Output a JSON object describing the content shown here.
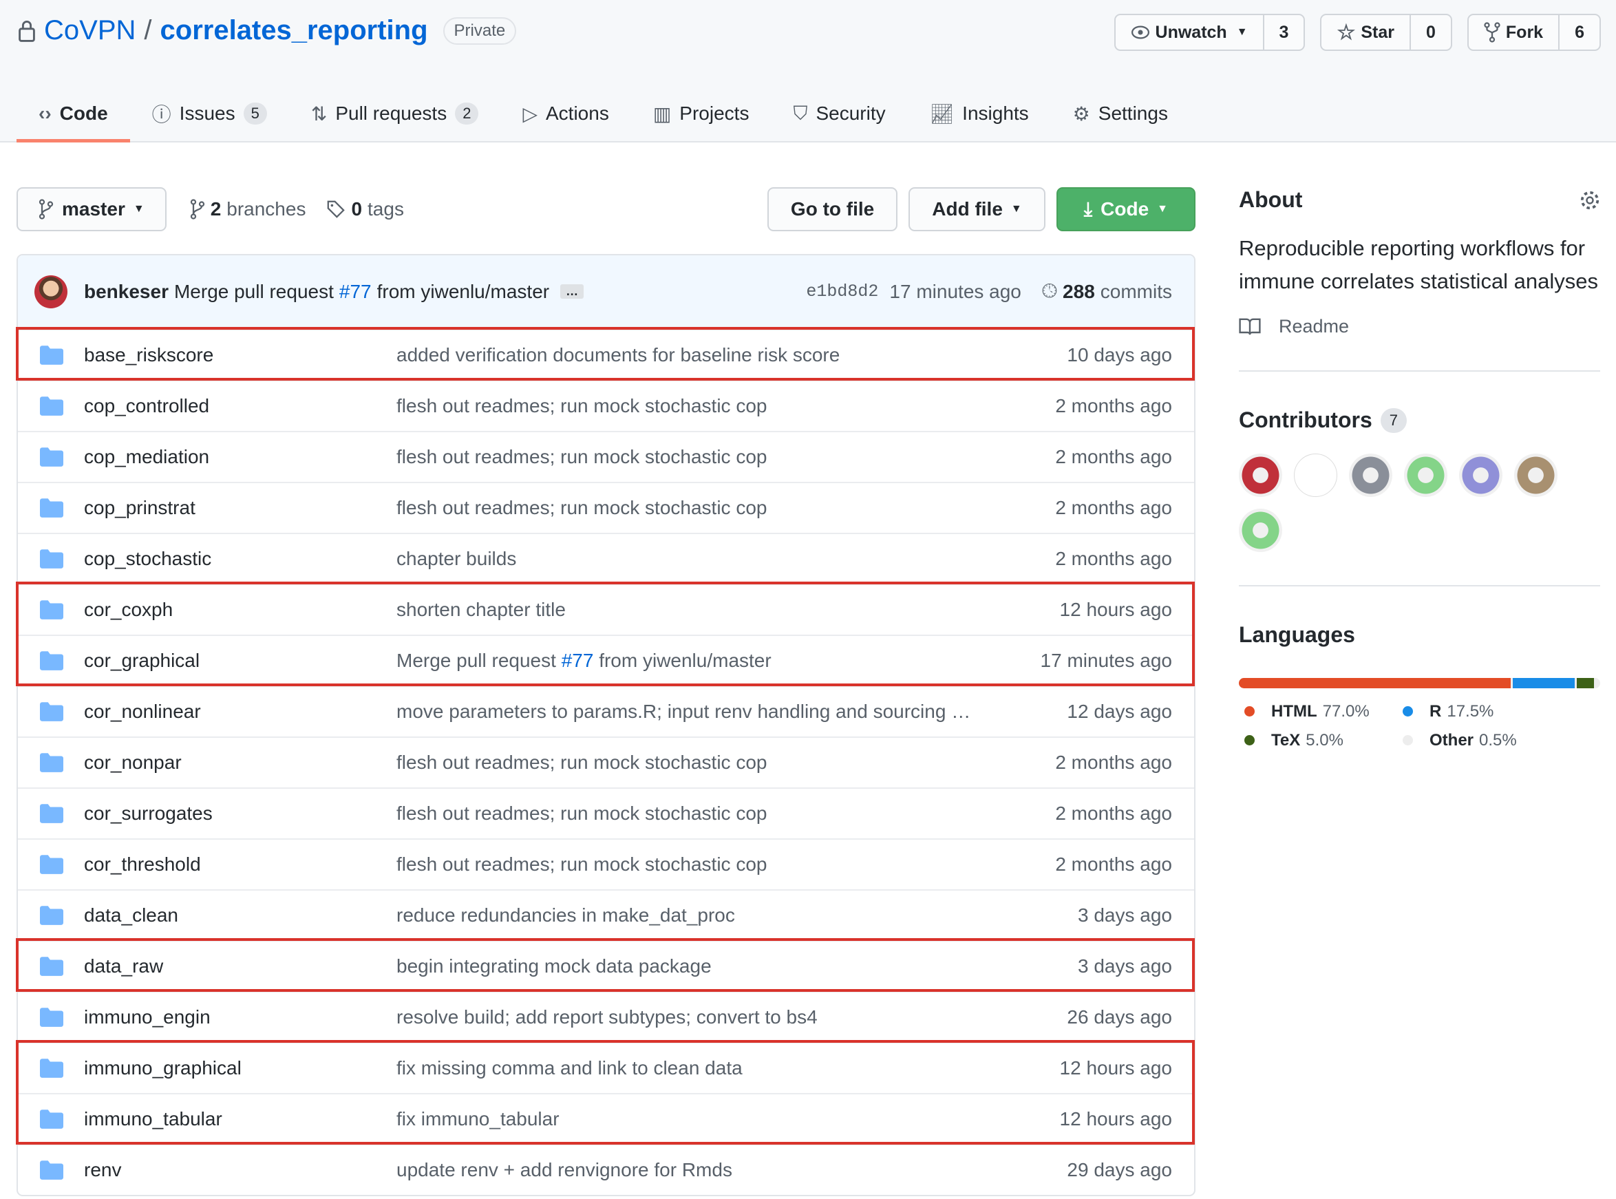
{
  "repo": {
    "owner": "CoVPN",
    "name": "correlates_reporting",
    "visibility": "Private"
  },
  "actions": {
    "watch_label": "Unwatch",
    "watch_count": "3",
    "star_label": "Star",
    "star_count": "0",
    "fork_label": "Fork",
    "fork_count": "6"
  },
  "tabs": [
    {
      "label": "Code",
      "icon": "code-icon",
      "active": true
    },
    {
      "label": "Issues",
      "icon": "issue-icon",
      "count": "5"
    },
    {
      "label": "Pull requests",
      "icon": "pull-request-icon",
      "count": "2"
    },
    {
      "label": "Actions",
      "icon": "play-icon"
    },
    {
      "label": "Projects",
      "icon": "project-icon"
    },
    {
      "label": "Security",
      "icon": "shield-icon"
    },
    {
      "label": "Insights",
      "icon": "graph-icon"
    },
    {
      "label": "Settings",
      "icon": "gear-icon"
    }
  ],
  "toolbar": {
    "branch": "master",
    "branches_count": "2",
    "branches_label": "branches",
    "tags_count": "0",
    "tags_label": "tags",
    "go_to_file": "Go to file",
    "add_file": "Add file",
    "code": "Code"
  },
  "commit": {
    "author": "benkeser",
    "message_pre": "Merge pull request",
    "pr": "#77",
    "message_post": "from yiwenlu/master",
    "ellipsis": "…",
    "sha": "e1bd8d2",
    "age": "17 minutes ago",
    "commits_count": "288",
    "commits_label": "commits"
  },
  "files": [
    {
      "name": "base_riskscore",
      "message": "added verification documents for baseline risk score",
      "age": "10 days ago",
      "highlighted": true
    },
    {
      "name": "cop_controlled",
      "message": "flesh out readmes; run mock stochastic cop",
      "age": "2 months ago"
    },
    {
      "name": "cop_mediation",
      "message": "flesh out readmes; run mock stochastic cop",
      "age": "2 months ago"
    },
    {
      "name": "cop_prinstrat",
      "message": "flesh out readmes; run mock stochastic cop",
      "age": "2 months ago"
    },
    {
      "name": "cop_stochastic",
      "message": "chapter builds",
      "age": "2 months ago"
    },
    {
      "name": "cor_coxph",
      "message": "shorten chapter title",
      "age": "12 hours ago",
      "highlighted": true
    },
    {
      "name": "cor_graphical",
      "message": "Merge pull request",
      "link": "#77",
      "message_post": "from yiwenlu/master",
      "age": "17 minutes ago",
      "highlighted": true
    },
    {
      "name": "cor_nonlinear",
      "message": "move parameters to params.R; input renv handling and sourcing …",
      "age": "12 days ago"
    },
    {
      "name": "cor_nonpar",
      "message": "flesh out readmes; run mock stochastic cop",
      "age": "2 months ago"
    },
    {
      "name": "cor_surrogates",
      "message": "flesh out readmes; run mock stochastic cop",
      "age": "2 months ago"
    },
    {
      "name": "cor_threshold",
      "message": "flesh out readmes; run mock stochastic cop",
      "age": "2 months ago"
    },
    {
      "name": "data_clean",
      "message": "reduce redundancies in make_dat_proc",
      "age": "3 days ago"
    },
    {
      "name": "data_raw",
      "message": "begin integrating mock data package",
      "age": "3 days ago",
      "highlighted": true
    },
    {
      "name": "immuno_engin",
      "message": "resolve build; add report subtypes; convert to bs4",
      "age": "26 days ago"
    },
    {
      "name": "immuno_graphical",
      "message": "fix missing comma and link to clean data",
      "age": "12 hours ago",
      "highlighted": true
    },
    {
      "name": "immuno_tabular",
      "message": "fix immuno_tabular",
      "age": "12 hours ago",
      "highlighted": true
    },
    {
      "name": "renv",
      "message": "update renv + add renvignore for Rmds",
      "age": "29 days ago"
    }
  ],
  "about": {
    "title": "About",
    "description": "Reproducible reporting workflows for immune correlates statistical analyses",
    "readme": "Readme"
  },
  "contributors": {
    "title": "Contributors",
    "count": "7",
    "avatars": [
      "#c0303a",
      "#ffffff",
      "#8a8f99",
      "#84d488",
      "#9090d8",
      "#a89070",
      "#84d488"
    ]
  },
  "languages": {
    "title": "Languages",
    "items": [
      {
        "name": "HTML",
        "percent": 77.0,
        "label": "77.0%",
        "color": "#e34c26"
      },
      {
        "name": "R",
        "percent": 17.5,
        "label": "17.5%",
        "color": "#198ce7"
      },
      {
        "name": "TeX",
        "percent": 5.0,
        "label": "5.0%",
        "color": "#3d6117"
      },
      {
        "name": "Other",
        "percent": 0.5,
        "label": "0.5%",
        "color": "#ededed"
      }
    ]
  },
  "colors": {
    "accent": "#0366d6",
    "tab_underline": "#f9826c",
    "code_button": "#2ea44f",
    "highlight_box": "#d9332b",
    "folder": "#79b8ff"
  }
}
